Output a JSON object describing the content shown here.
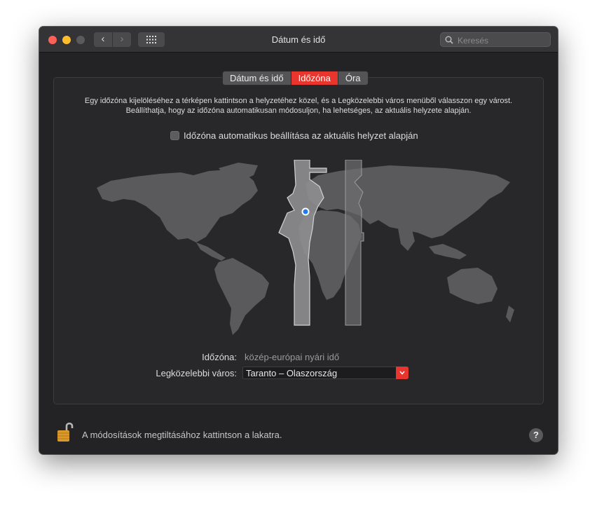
{
  "window": {
    "title": "Dátum és idő"
  },
  "toolbar": {
    "back_icon": "chevron-left-icon",
    "forward_icon": "chevron-right-icon",
    "grid_icon": "grid-icon",
    "search_placeholder": "Keresés"
  },
  "tabs": [
    {
      "label": "Dátum és idő",
      "active": false
    },
    {
      "label": "Időzóna",
      "active": true
    },
    {
      "label": "Óra",
      "active": false
    }
  ],
  "instructions": {
    "line1": "Egy időzóna kijelöléséhez a térképen kattintson a helyzetéhez közel, és a Legközelebbi város menüből válasszon egy várost.",
    "line2": "Beállíthatja, hogy az időzóna automatikusan módosuljon, ha lehetséges, az aktuális helyzete alapján."
  },
  "auto_timezone": {
    "label": "Időzóna automatikus beállítása az aktuális helyzet alapján",
    "checked": false
  },
  "timezone": {
    "label": "Időzóna:",
    "value": "közép-európai nyári idő"
  },
  "closest_city": {
    "label": "Legközelebbi város:",
    "value": "Taranto – Olaszország"
  },
  "footer": {
    "lock_text": "A módosítások megtiltásához kattintson a lakatra.",
    "lock_icon": "padlock-open-icon",
    "help_label": "?"
  },
  "colors": {
    "accent": "#e8352d",
    "window_bg": "#232325",
    "map_land": "#5a5a5c",
    "selected_zone": "#8e8e90",
    "location_pin": "#1e7cf2"
  }
}
